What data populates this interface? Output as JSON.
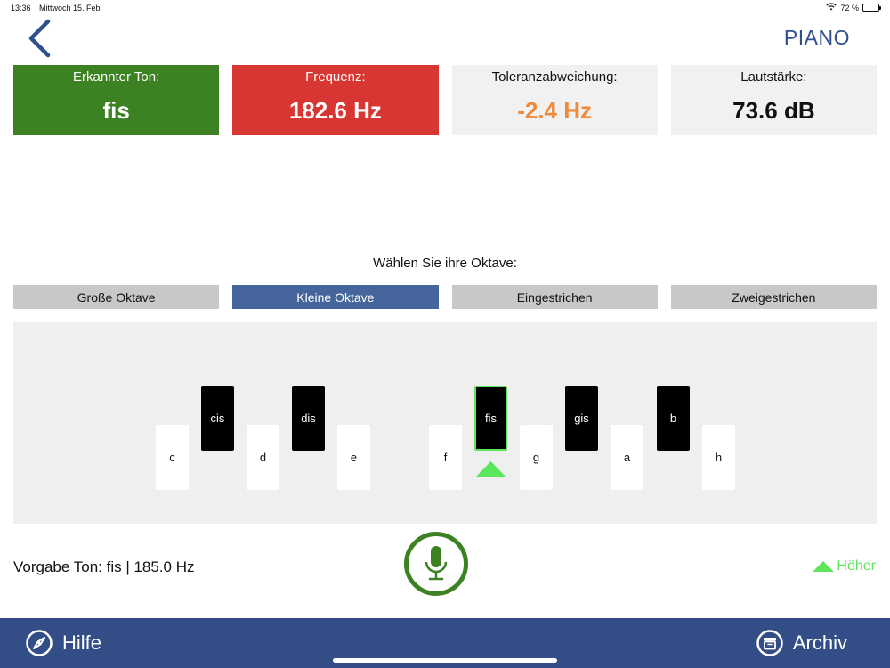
{
  "status": {
    "time": "13:36",
    "date": "Mittwoch 15. Feb.",
    "battery": "72 %",
    "battery_level": 0.72
  },
  "nav": {
    "title": "PIANO"
  },
  "cards": {
    "note": {
      "label": "Erkannter Ton:",
      "value": "fis"
    },
    "frequency": {
      "label": "Frequenz:",
      "value": "182.6 Hz"
    },
    "tolerance": {
      "label": "Toleranzabweichung:",
      "value": "-2.4 Hz"
    },
    "volume": {
      "label": "Lautstärke:",
      "value": "73.6 dB"
    }
  },
  "octave_prompt": "Wählen Sie ihre Oktave:",
  "octaves": [
    {
      "label": "Große Oktave",
      "active": false
    },
    {
      "label": "Kleine Oktave",
      "active": true
    },
    {
      "label": "Eingestrichen",
      "active": false
    },
    {
      "label": "Zweigestrichen",
      "active": false
    }
  ],
  "keys": {
    "white": [
      "c",
      "d",
      "e",
      "f",
      "g",
      "a",
      "h"
    ],
    "black": [
      "cis",
      "dis",
      "fis",
      "gis",
      "b"
    ],
    "selected": "fis"
  },
  "target": "Vorgabe Ton: fis | 185.0 Hz",
  "direction": "Höher",
  "bottom": {
    "help": "Hilfe",
    "archive": "Archiv"
  },
  "colors": {
    "card_green": "#3d8222",
    "card_red": "#d83632",
    "tolerance_orange": "#ef8a3c",
    "active_octave": "#45659c",
    "bottom_bar": "#334d87",
    "pointer_green": "#5ce65c"
  }
}
